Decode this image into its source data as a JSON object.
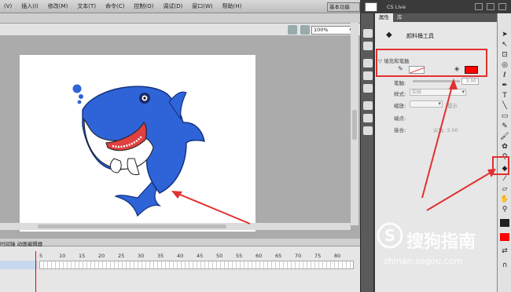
{
  "menu": {
    "items": [
      "(V)",
      "插入(I)",
      "修改(M)",
      "文本(T)",
      "命令(C)",
      "控制(O)",
      "调试(D)",
      "窗口(W)",
      "帮助(H)"
    ]
  },
  "titlebar": {
    "workspace_label": "基本功能",
    "search_placeholder": "",
    "cs_live": "CS Live"
  },
  "stage": {
    "zoom": "100%"
  },
  "timeline": {
    "tab_label": "时间轴 动画编辑器",
    "ruler_ticks": [
      "5",
      "10",
      "15",
      "20",
      "25",
      "30",
      "35",
      "40",
      "45",
      "50",
      "55",
      "60",
      "65",
      "70",
      "75",
      "80"
    ]
  },
  "properties": {
    "tabs": [
      "属性",
      "库"
    ],
    "tool_name": "颜料桶工具",
    "section_fill_stroke": "▽ 填充和笔触",
    "stroke_label": "笔触:",
    "stroke_value": "3.00",
    "style_label": "样式:",
    "style_value": "实线",
    "scale_label": "缩放:",
    "hint_label": "提示",
    "cap_label": "端点:",
    "join_label": "接合:",
    "sharp_label": "尖角: 3.00",
    "fill_color": "#ff0000"
  },
  "watermark": {
    "brand": "搜狗指南",
    "url": "zhinan.sogou.com"
  },
  "colors": {
    "shark_blue": "#2f63d8",
    "annotation_red": "#e23030"
  }
}
